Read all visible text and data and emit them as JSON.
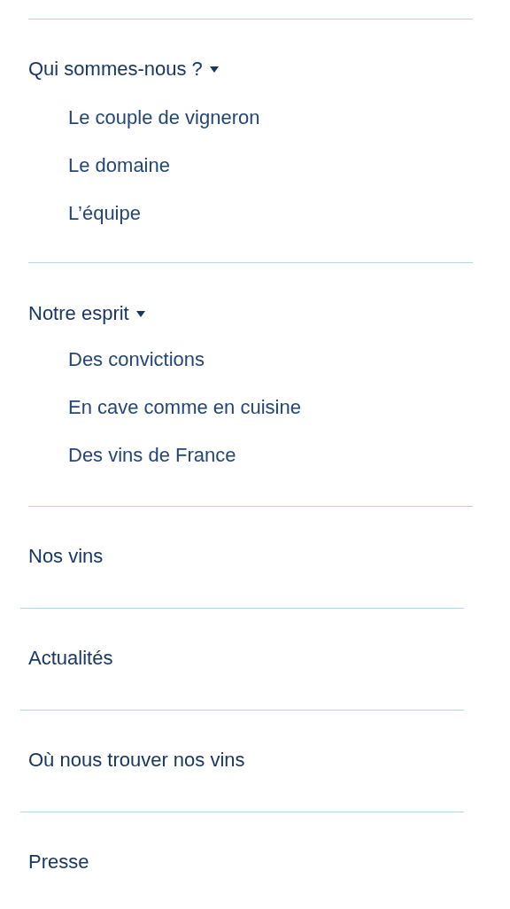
{
  "menu": [
    {
      "label": "Qui sommes-nous ?",
      "expanded": true,
      "children": [
        {
          "label": "Le couple de vigneron"
        },
        {
          "label": "Le domaine"
        },
        {
          "label": "L’équipe"
        }
      ]
    },
    {
      "label": "Notre esprit",
      "expanded": true,
      "children": [
        {
          "label": "Des convictions"
        },
        {
          "label": "En cave comme en cuisine"
        },
        {
          "label": "Des vins de France"
        }
      ]
    },
    {
      "label": "Nos vins"
    },
    {
      "label": "Actualités"
    },
    {
      "label": "Où nous trouver nos vins"
    },
    {
      "label": "Presse"
    }
  ]
}
